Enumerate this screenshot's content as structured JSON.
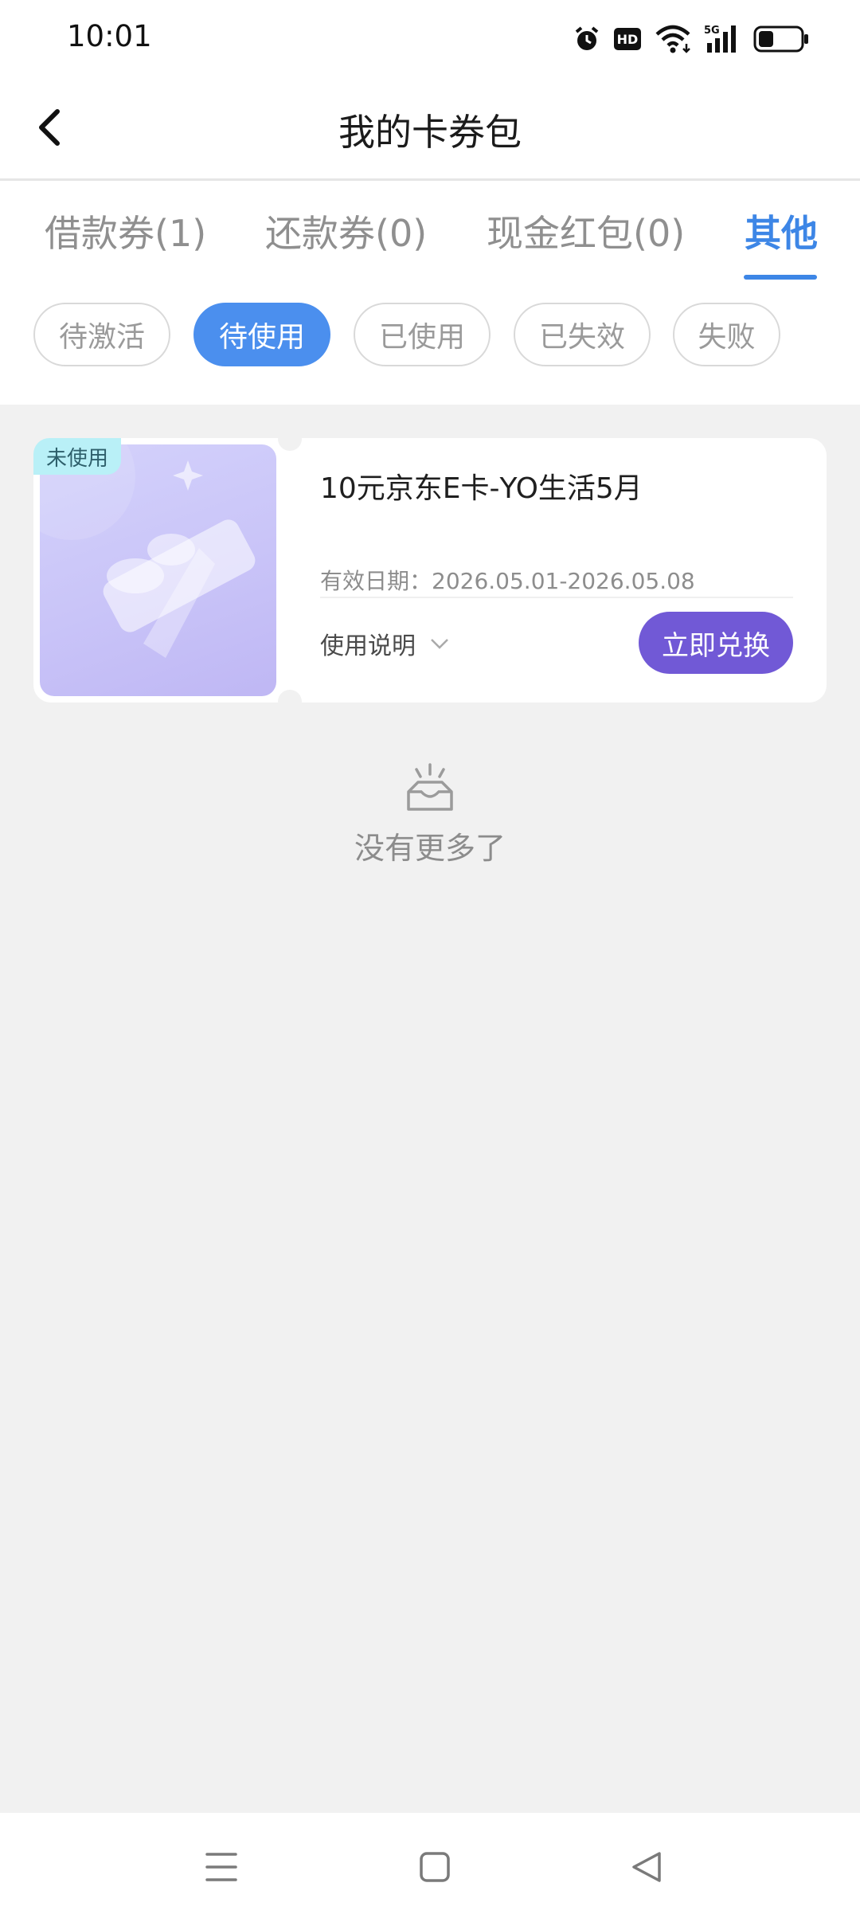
{
  "status_bar": {
    "time": "10:01",
    "icons": [
      "alarm-icon",
      "hd-icon",
      "wifi-icon",
      "5g-signal-icon",
      "battery-icon"
    ],
    "network_label": "5G",
    "hd_label": "HD",
    "battery_level": 0.35
  },
  "header": {
    "title": "我的卡券包",
    "back_icon": "chevron-left-icon"
  },
  "tabs": [
    {
      "label": "借款券(1)",
      "active": false
    },
    {
      "label": "还款券(0)",
      "active": false
    },
    {
      "label": "现金红包(0)",
      "active": false
    },
    {
      "label": "其他",
      "active": true
    }
  ],
  "filters": [
    {
      "label": "待激活",
      "active": false
    },
    {
      "label": "待使用",
      "active": true
    },
    {
      "label": "已使用",
      "active": false
    },
    {
      "label": "已失效",
      "active": false
    },
    {
      "label": "失败",
      "active": false
    }
  ],
  "coupon": {
    "status_tag": "未使用",
    "title": "10元京东E卡-YO生活5月",
    "validity": "有效日期：2026.05.01-2026.05.08",
    "usage_label": "使用说明",
    "redeem_label": "立即兑换",
    "image_icon": "gift-box-icon"
  },
  "empty_state": {
    "text": "没有更多了",
    "icon": "empty-tray-icon"
  },
  "nav_bar": {
    "icons": [
      "menu-icon",
      "home-square-icon",
      "back-triangle-icon"
    ]
  },
  "colors": {
    "accent_blue": "#3d86e6",
    "chip_active": "#4b8fee",
    "redeem_purple": "#7159d6",
    "tag_cyan": "#b9f0f7",
    "page_bg": "#f1f1f1"
  }
}
